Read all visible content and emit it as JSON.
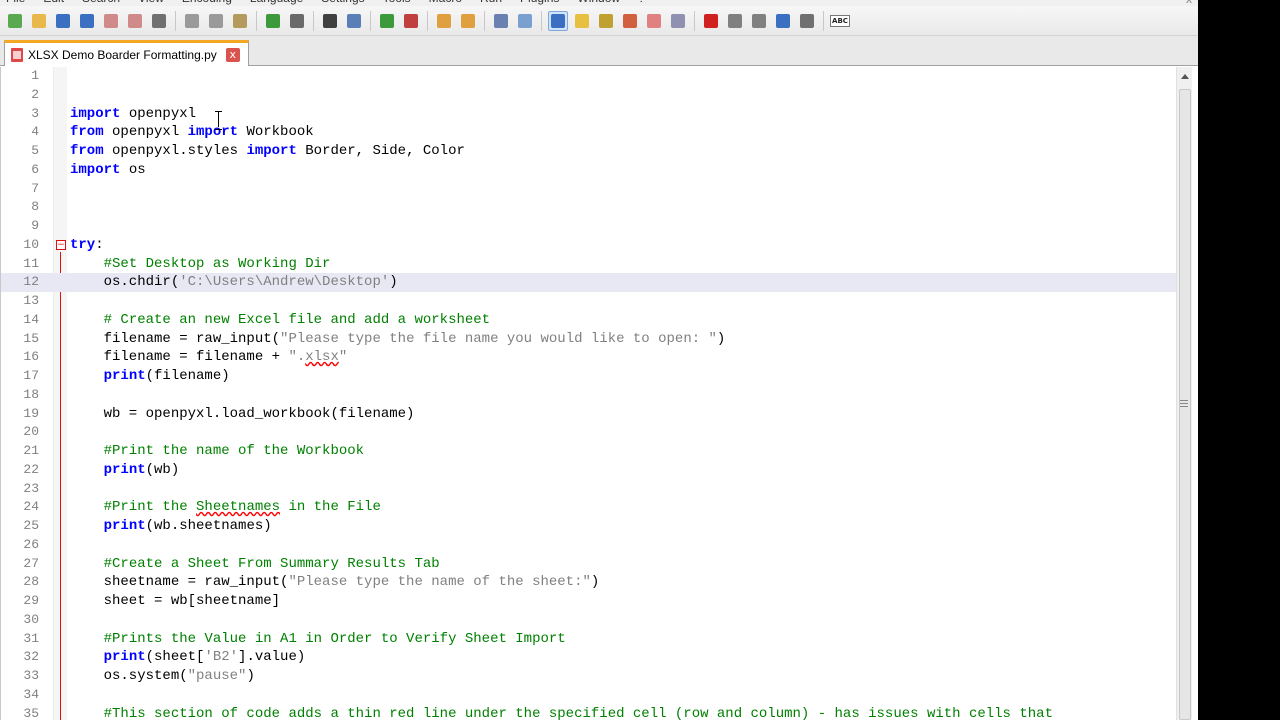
{
  "menu": {
    "items": [
      "File",
      "Edit",
      "Search",
      "View",
      "Encoding",
      "Language",
      "Settings",
      "Tools",
      "Macro",
      "Run",
      "Plugins",
      "Window",
      "?"
    ],
    "close": "x"
  },
  "toolbar": {
    "buttons": [
      {
        "icon": "new-file-icon",
        "color": "#5aa84f"
      },
      {
        "icon": "open-file-icon",
        "color": "#e8b84a"
      },
      {
        "icon": "save-icon",
        "color": "#3b6fc2"
      },
      {
        "icon": "save-all-icon",
        "color": "#3b6fc2"
      },
      {
        "icon": "close-icon",
        "color": "#d08a8a"
      },
      {
        "icon": "close-all-icon",
        "color": "#d08a8a"
      },
      {
        "icon": "print-icon",
        "color": "#707070"
      },
      {
        "icon": "cut-icon",
        "color": "#9a9a9a"
      },
      {
        "icon": "copy-icon",
        "color": "#9a9a9a"
      },
      {
        "icon": "paste-icon",
        "color": "#b49a5c"
      },
      {
        "icon": "undo-icon",
        "color": "#3c9a3c"
      },
      {
        "icon": "redo-icon",
        "color": "#6a6a6a"
      },
      {
        "icon": "find-icon",
        "color": "#404040"
      },
      {
        "icon": "replace-icon",
        "color": "#5a7fb8"
      },
      {
        "icon": "zoom-in-icon",
        "color": "#3c9a3c"
      },
      {
        "icon": "zoom-out-icon",
        "color": "#c04040"
      },
      {
        "icon": "sync-vertical-icon",
        "color": "#e0a040"
      },
      {
        "icon": "sync-horizontal-icon",
        "color": "#e0a040"
      },
      {
        "icon": "word-wrap-icon",
        "color": "#6a80b0"
      },
      {
        "icon": "show-all-chars-icon",
        "color": "#7aa0d0"
      },
      {
        "icon": "indent-guide-icon",
        "color": "#3b6fc2",
        "active": true
      },
      {
        "icon": "user-language-icon",
        "color": "#e8c040"
      },
      {
        "icon": "doc-map-icon",
        "color": "#c0a030"
      },
      {
        "icon": "function-list-icon",
        "color": "#d06040"
      },
      {
        "icon": "folder-workspace-icon",
        "color": "#e08080"
      },
      {
        "icon": "monitoring-icon",
        "color": "#9090b0"
      },
      {
        "icon": "record-macro-icon",
        "color": "#d02020"
      },
      {
        "icon": "stop-macro-icon",
        "color": "#808080"
      },
      {
        "icon": "play-macro-icon",
        "color": "#808080"
      },
      {
        "icon": "run-macro-multiple-icon",
        "color": "#3b6fc2"
      },
      {
        "icon": "save-macro-icon",
        "color": "#707070"
      },
      {
        "icon": "spell-check-icon",
        "label": "ABC"
      }
    ]
  },
  "tab": {
    "label": "XLSX Demo Boarder Formatting.py",
    "close": "x"
  },
  "editor": {
    "lines": [
      {
        "n": "1",
        "tokens": []
      },
      {
        "n": "2",
        "tokens": []
      },
      {
        "n": "3",
        "tokens": [
          {
            "t": "kw",
            "v": "import"
          },
          {
            "t": "p",
            "v": " openpyxl"
          }
        ]
      },
      {
        "n": "4",
        "tokens": [
          {
            "t": "kw",
            "v": "from"
          },
          {
            "t": "p",
            "v": " openpyxl "
          },
          {
            "t": "kw",
            "v": "import"
          },
          {
            "t": "p",
            "v": " Workbook"
          }
        ]
      },
      {
        "n": "5",
        "tokens": [
          {
            "t": "kw",
            "v": "from"
          },
          {
            "t": "p",
            "v": " openpyxl.styles "
          },
          {
            "t": "kw",
            "v": "import"
          },
          {
            "t": "p",
            "v": " Border, Side, Color"
          }
        ]
      },
      {
        "n": "6",
        "tokens": [
          {
            "t": "kw",
            "v": "import"
          },
          {
            "t": "p",
            "v": " os"
          }
        ]
      },
      {
        "n": "7",
        "tokens": []
      },
      {
        "n": "8",
        "tokens": []
      },
      {
        "n": "9",
        "tokens": []
      },
      {
        "n": "10",
        "tokens": [
          {
            "t": "kw",
            "v": "try"
          },
          {
            "t": "p",
            "v": ":"
          }
        ]
      },
      {
        "n": "11",
        "tokens": [
          {
            "t": "p",
            "v": "    "
          },
          {
            "t": "cm",
            "v": "#Set Desktop as Working Dir"
          }
        ]
      },
      {
        "n": "12",
        "current": true,
        "tokens": [
          {
            "t": "p",
            "v": "    os.chdir("
          },
          {
            "t": "st",
            "v": "'C:\\Users\\Andrew\\Desktop'"
          },
          {
            "t": "p",
            "v": ")"
          }
        ]
      },
      {
        "n": "13",
        "tokens": []
      },
      {
        "n": "14",
        "tokens": [
          {
            "t": "p",
            "v": "    "
          },
          {
            "t": "cm",
            "v": "# Create an new Excel file and add a worksheet"
          }
        ]
      },
      {
        "n": "15",
        "tokens": [
          {
            "t": "p",
            "v": "    filename = raw_input("
          },
          {
            "t": "st",
            "v": "\"Please type the file name you would like to open: \""
          },
          {
            "t": "p",
            "v": ")"
          }
        ]
      },
      {
        "n": "16",
        "tokens": [
          {
            "t": "p",
            "v": "    filename = filename + "
          },
          {
            "t": "st",
            "v": "\"."
          },
          {
            "t": "st-err",
            "v": "xlsx"
          },
          {
            "t": "st",
            "v": "\""
          }
        ]
      },
      {
        "n": "17",
        "tokens": [
          {
            "t": "p",
            "v": "    "
          },
          {
            "t": "kw",
            "v": "print"
          },
          {
            "t": "p",
            "v": "(filename)"
          }
        ]
      },
      {
        "n": "18",
        "tokens": []
      },
      {
        "n": "19",
        "tokens": [
          {
            "t": "p",
            "v": "    wb = openpyxl.load_workbook(filename)"
          }
        ]
      },
      {
        "n": "20",
        "tokens": []
      },
      {
        "n": "21",
        "tokens": [
          {
            "t": "p",
            "v": "    "
          },
          {
            "t": "cm",
            "v": "#Print the name of the Workbook"
          }
        ]
      },
      {
        "n": "22",
        "tokens": [
          {
            "t": "p",
            "v": "    "
          },
          {
            "t": "kw",
            "v": "print"
          },
          {
            "t": "p",
            "v": "(wb)"
          }
        ]
      },
      {
        "n": "23",
        "tokens": []
      },
      {
        "n": "24",
        "tokens": [
          {
            "t": "p",
            "v": "    "
          },
          {
            "t": "cm",
            "v": "#Print the "
          },
          {
            "t": "cm-err",
            "v": "Sheetnames"
          },
          {
            "t": "cm",
            "v": " in the File"
          }
        ]
      },
      {
        "n": "25",
        "tokens": [
          {
            "t": "p",
            "v": "    "
          },
          {
            "t": "kw",
            "v": "print"
          },
          {
            "t": "p",
            "v": "(wb.sheetnames)"
          }
        ]
      },
      {
        "n": "26",
        "tokens": []
      },
      {
        "n": "27",
        "tokens": [
          {
            "t": "p",
            "v": "    "
          },
          {
            "t": "cm",
            "v": "#Create a Sheet From Summary Results Tab"
          }
        ]
      },
      {
        "n": "28",
        "tokens": [
          {
            "t": "p",
            "v": "    sheetname = raw_input("
          },
          {
            "t": "st",
            "v": "\"Please type the name of the sheet:\""
          },
          {
            "t": "p",
            "v": ")"
          }
        ]
      },
      {
        "n": "29",
        "tokens": [
          {
            "t": "p",
            "v": "    sheet = wb[sheetname]"
          }
        ]
      },
      {
        "n": "30",
        "tokens": []
      },
      {
        "n": "31",
        "tokens": [
          {
            "t": "p",
            "v": "    "
          },
          {
            "t": "cm",
            "v": "#Prints the Value in A1 in Order to Verify Sheet Import"
          }
        ]
      },
      {
        "n": "32",
        "tokens": [
          {
            "t": "p",
            "v": "    "
          },
          {
            "t": "kw",
            "v": "print"
          },
          {
            "t": "p",
            "v": "(sheet["
          },
          {
            "t": "st",
            "v": "'B2'"
          },
          {
            "t": "p",
            "v": "].value)"
          }
        ]
      },
      {
        "n": "33",
        "tokens": [
          {
            "t": "p",
            "v": "    os.system("
          },
          {
            "t": "st",
            "v": "\"pause\""
          },
          {
            "t": "p",
            "v": ")"
          }
        ]
      },
      {
        "n": "34",
        "tokens": []
      },
      {
        "n": "35",
        "tokens": [
          {
            "t": "p",
            "v": "    "
          },
          {
            "t": "cm",
            "v": "#This section of code adds a thin red line under the specified cell (row and column) - has issues with cells that"
          }
        ]
      }
    ],
    "fold_symbol": "−"
  }
}
